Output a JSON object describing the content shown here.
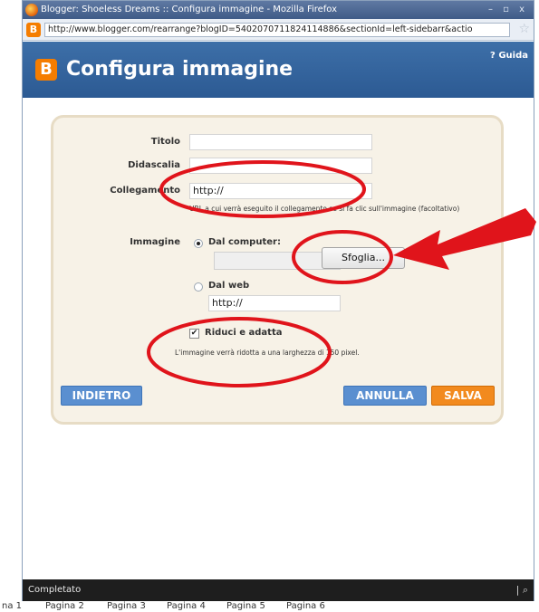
{
  "window": {
    "title": "Blogger: Shoeless Dreams :: Configura immagine - Mozilla Firefox",
    "controls": "– ▫ x"
  },
  "address_bar": {
    "url": "http://www.blogger.com/rearrange?blogID=5402070711824114886&sectionId=left-sidebarr&actio"
  },
  "header": {
    "title": "Configura immagine",
    "help_label": "Guida"
  },
  "form": {
    "title_label": "Titolo",
    "title_value": "",
    "caption_label": "Didascalia",
    "caption_value": "",
    "link_label": "Collegamento",
    "link_value": "http://",
    "link_hint": "URL a cui verrà eseguito il collegamento se si fa clic sull'immagine (facoltativo)",
    "image_label": "Immagine",
    "from_computer_label": "Dal computer:",
    "browse_label": "Sfoglia...",
    "from_web_label": "Dal web",
    "web_url_value": "http://",
    "resize_label": "Riduci e adatta",
    "resize_hint": "L'immagine verrà ridotta a una larghezza di 150 pixel."
  },
  "buttons": {
    "back": "INDIETRO",
    "cancel": "ANNULLA",
    "save": "SALVA"
  },
  "status": {
    "text": "Completato"
  },
  "page_tabs": [
    "na 1",
    "Pagina 2",
    "Pagina 3",
    "Pagina 4",
    "Pagina 5",
    "Pagina 6"
  ],
  "colors": {
    "header": "#2c5a93",
    "accent_orange": "#f57d00",
    "annotation_red": "#e0141b"
  }
}
